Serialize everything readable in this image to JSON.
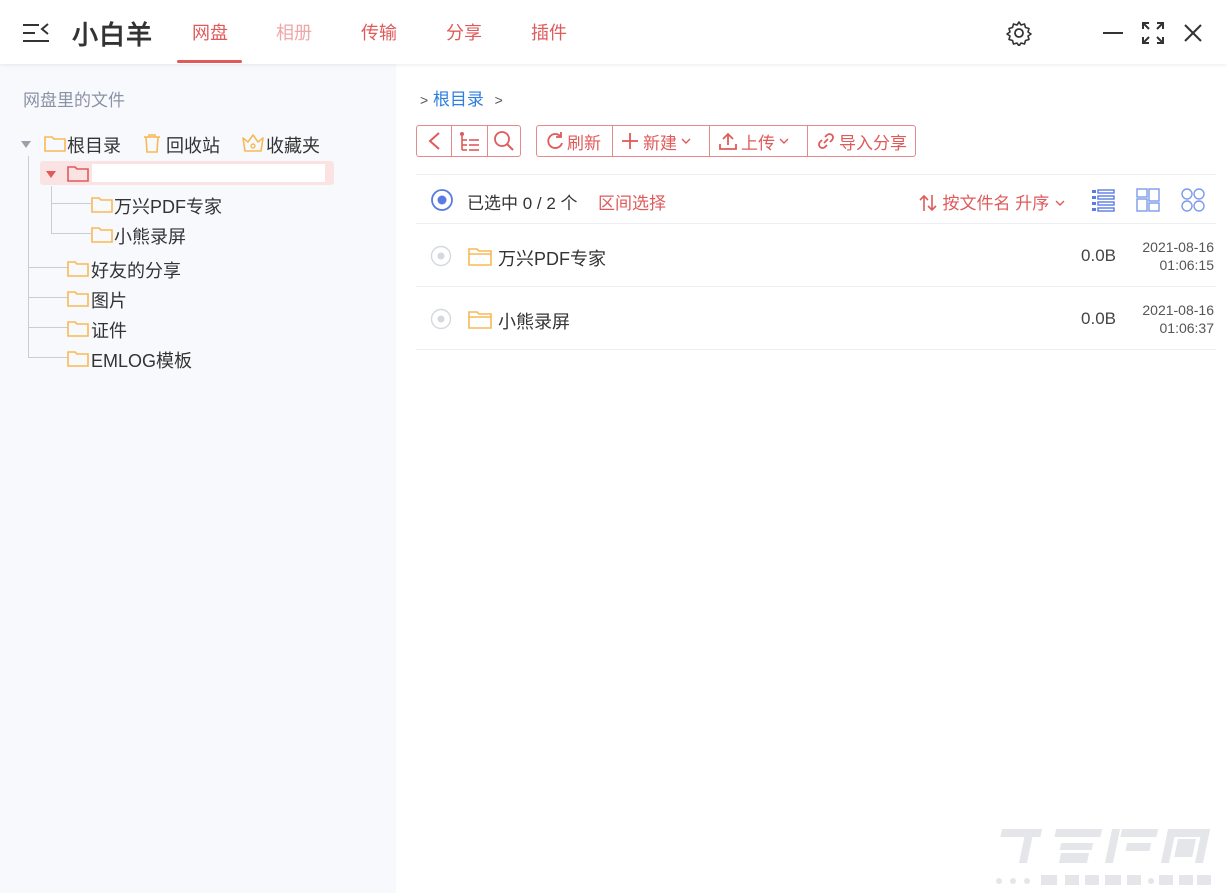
{
  "app": {
    "title": "小白羊"
  },
  "tabs": [
    {
      "label": "网盘",
      "active": true
    },
    {
      "label": "相册",
      "disabled": true
    },
    {
      "label": "传输"
    },
    {
      "label": "分享"
    },
    {
      "label": "插件"
    }
  ],
  "header_icons": [
    "menu-collapse-icon",
    "gear-icon",
    "minimize-icon",
    "maximize-icon",
    "close-icon"
  ],
  "sidebar": {
    "heading": "网盘里的文件",
    "quick": [
      {
        "label": "根目录",
        "icon": "folder-icon"
      },
      {
        "label": "回收站",
        "icon": "trash-icon"
      },
      {
        "label": "收藏夹",
        "icon": "favorite-folder-icon"
      }
    ],
    "tree": {
      "subfolders": [
        "万兴PDF专家",
        "小熊录屏"
      ],
      "others": [
        "好友的分享",
        "图片",
        "证件",
        "EMLOG模板"
      ]
    }
  },
  "breadcrumb": {
    "prefix": ">",
    "root": "根目录",
    "suffix": ">"
  },
  "toolbar": {
    "refresh": "刷新",
    "new": "新建",
    "upload": "上传",
    "import_share": "导入分享"
  },
  "selection": {
    "status": "已选中 0 / 2 个",
    "range_select": "区间选择",
    "sort": "按文件名 升序"
  },
  "files": [
    {
      "name": "万兴PDF专家",
      "size": "0.0B",
      "date": "2021-08-16",
      "time": "01:06:15"
    },
    {
      "name": "小熊录屏",
      "size": "0.0B",
      "date": "2021-08-16",
      "time": "01:06:37"
    }
  ],
  "colors": {
    "accent": "#e05a5a",
    "link": "#2f7ee0",
    "folder": "#f7b955",
    "select": "#5b7be0"
  }
}
